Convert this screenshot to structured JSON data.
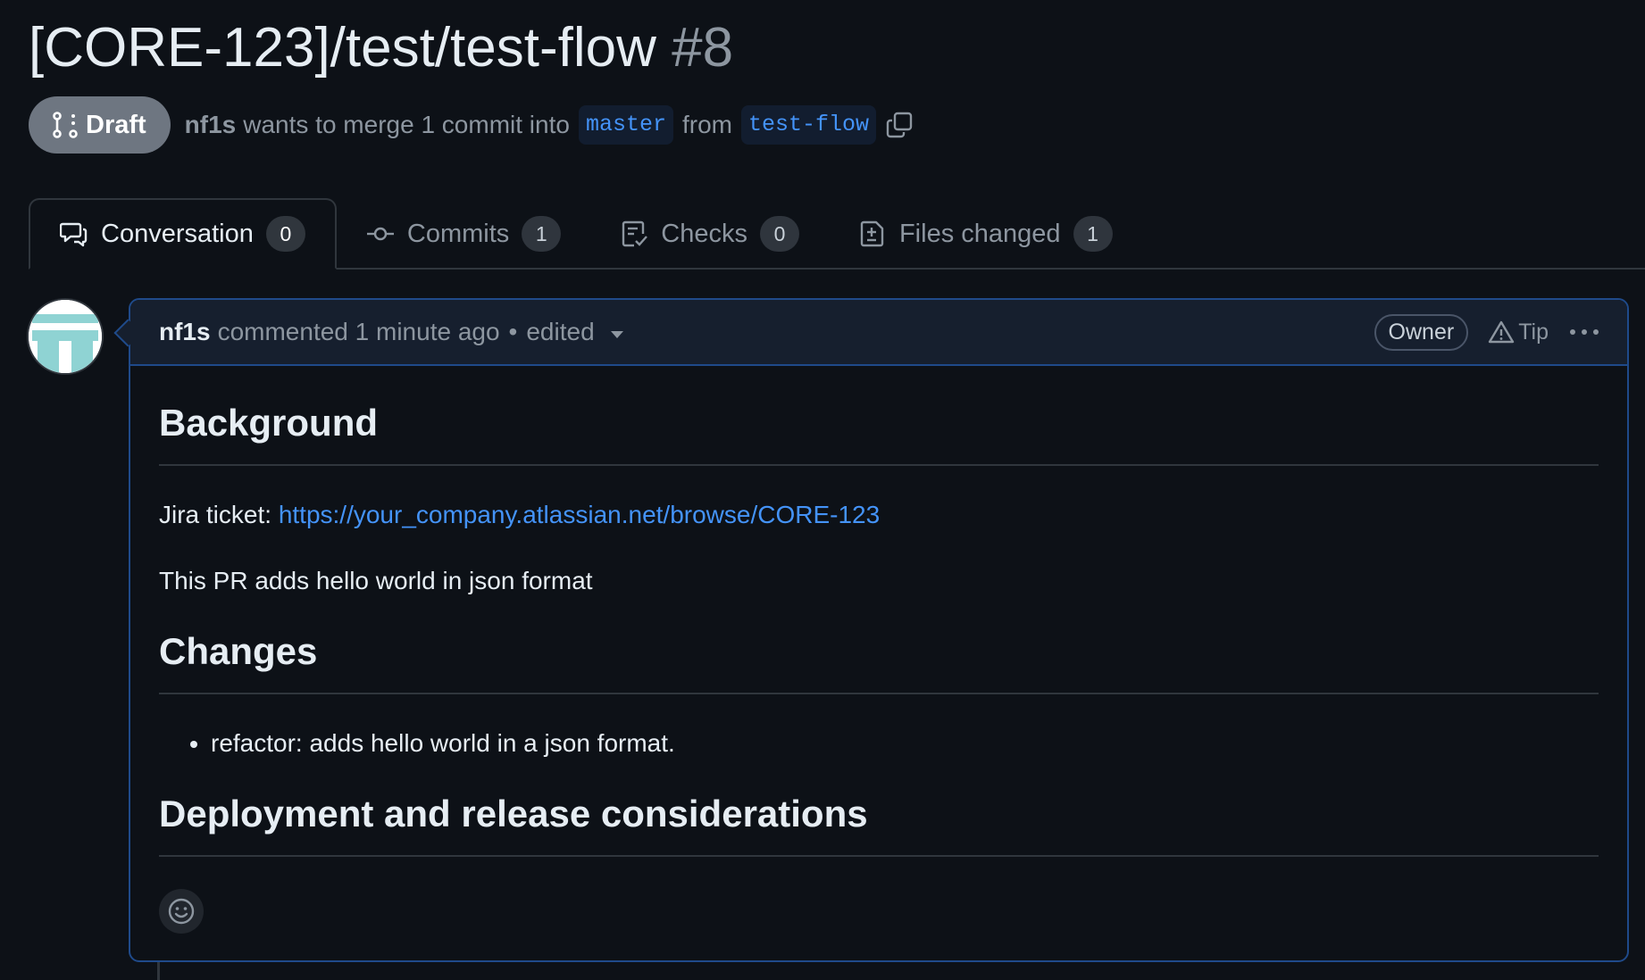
{
  "pr": {
    "title": "[CORE-123]/test/test-flow",
    "number": "#8",
    "draft_label": "Draft",
    "author": "nf1s",
    "merge_text": "wants to merge 1 commit into",
    "base_branch": "master",
    "from_text": "from",
    "head_branch": "test-flow"
  },
  "tabs": [
    {
      "label": "Conversation",
      "count": "0",
      "icon": "comment-discussion-icon"
    },
    {
      "label": "Commits",
      "count": "1",
      "icon": "git-commit-icon"
    },
    {
      "label": "Checks",
      "count": "0",
      "icon": "checklist-icon"
    },
    {
      "label": "Files changed",
      "count": "1",
      "icon": "file-diff-icon"
    }
  ],
  "comment": {
    "author": "nf1s",
    "action": "commented 1 minute ago",
    "separator": "•",
    "edited_label": "edited",
    "role_badge": "Owner",
    "tip_label": "Tip",
    "body": {
      "h_background": "Background",
      "jira_label": "Jira ticket:",
      "jira_link": "https://your_company.atlassian.net/browse/CORE-123",
      "description": "This PR adds hello world in json format",
      "h_changes": "Changes",
      "changes": [
        "refactor: adds hello world in a json format."
      ],
      "h_deployment": "Deployment and release considerations"
    }
  },
  "colors": {
    "background": "#0d1117",
    "link": "#4493f8",
    "draft_badge": "#6e7681",
    "comment_border": "#1f4a8a"
  }
}
